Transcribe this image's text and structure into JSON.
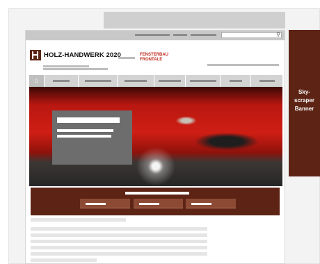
{
  "site": {
    "logo_text": "HOLZ-HANDWERK 2020",
    "partner_logo_line1": "FENSTERBAU",
    "partner_logo_line2_pre": "FR",
    "partner_logo_line2_o": "O",
    "partner_logo_line2_post": "NTALE",
    "search_icon": "magnifier-icon"
  },
  "banners": {
    "skyscraper_label": "Sky-\nscraper\nBanner"
  },
  "colors": {
    "brand": "#5d2415",
    "accent_red": "#c0281c",
    "placeholder_gray": "#cfcfcf"
  }
}
